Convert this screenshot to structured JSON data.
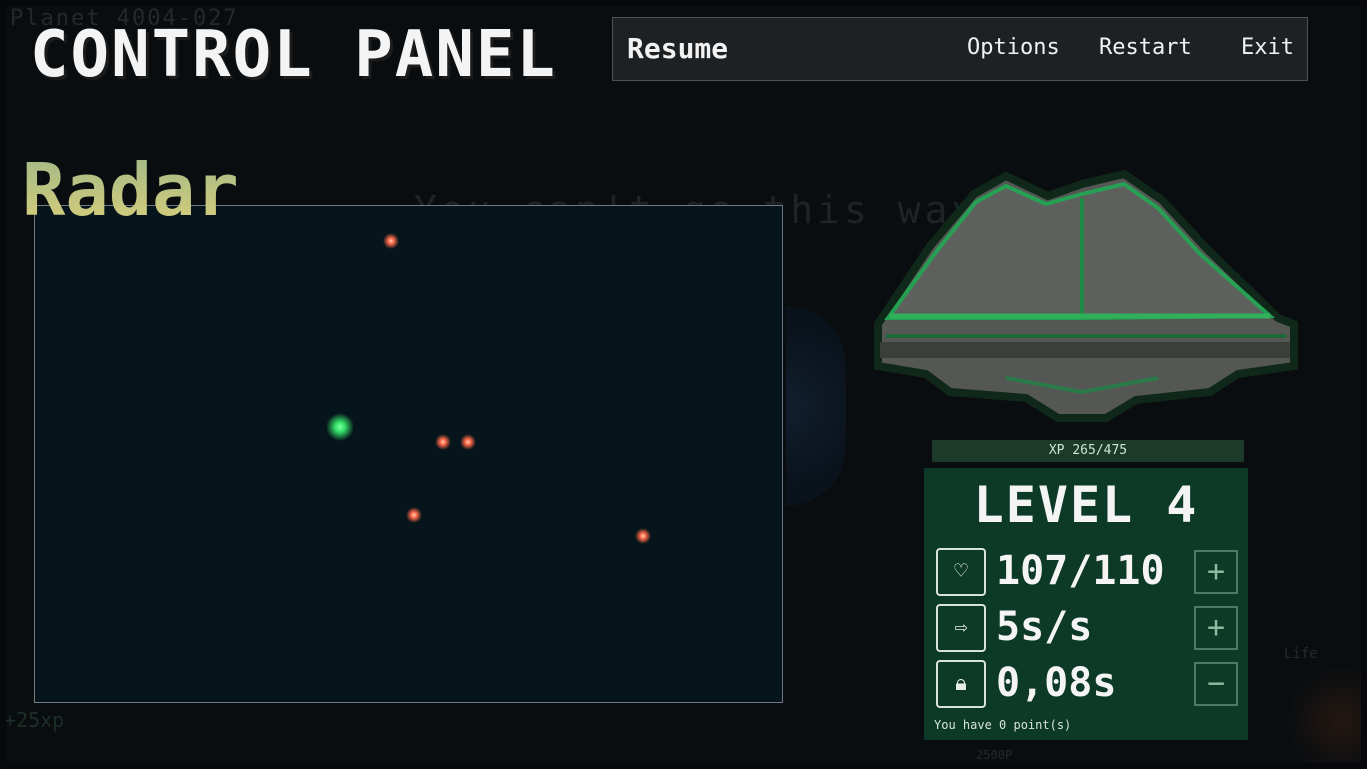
{
  "background": {
    "planet_label": "Planet 4004-027",
    "warning": "You can't go this way !",
    "xp_gain": "+25xp",
    "life_label": "Life",
    "bottom_hint": "2500P"
  },
  "title": "CONTROL PANEL",
  "menu": {
    "resume": "Resume",
    "options": "Options",
    "restart": "Restart",
    "exit": "Exit"
  },
  "radar": {
    "title": "Radar",
    "player_color": "#35e06a",
    "enemy_color": "#ff6a4a"
  },
  "stats": {
    "xp_label": "XP 265/475",
    "xp_current": 265,
    "xp_max": 475,
    "level": "LEVEL 4",
    "health": "107/110",
    "health_icon": "heart-icon",
    "speed": "5s/s",
    "speed_icon": "arrow-icon",
    "cooldown": "0,08s",
    "cooldown_icon": "lock-icon",
    "points": "You have 0 point(s)",
    "plus": "+",
    "minus": "−"
  }
}
